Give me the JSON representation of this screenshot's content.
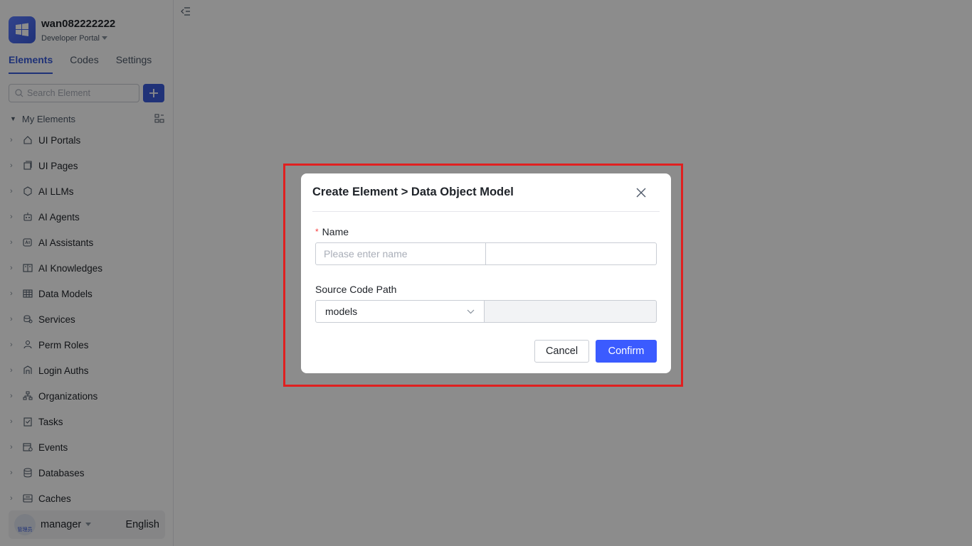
{
  "app": {
    "name": "wan082222222",
    "portal": "Developer Portal"
  },
  "tabs": [
    "Elements",
    "Codes",
    "Settings"
  ],
  "search": {
    "placeholder": "Search Element"
  },
  "tree": {
    "root_label": "My Elements",
    "items": [
      {
        "label": "UI Portals",
        "icon": "home-icon"
      },
      {
        "label": "UI Pages",
        "icon": "pages-icon"
      },
      {
        "label": "AI LLMs",
        "icon": "llm-icon"
      },
      {
        "label": "AI Agents",
        "icon": "robot-icon"
      },
      {
        "label": "AI Assistants",
        "icon": "ai-assistant-icon"
      },
      {
        "label": "AI Knowledges",
        "icon": "book-icon"
      },
      {
        "label": "Data Models",
        "icon": "table-icon"
      },
      {
        "label": "Services",
        "icon": "service-icon"
      },
      {
        "label": "Perm Roles",
        "icon": "role-icon"
      },
      {
        "label": "Login Auths",
        "icon": "login-icon"
      },
      {
        "label": "Organizations",
        "icon": "org-icon"
      },
      {
        "label": "Tasks",
        "icon": "task-icon"
      },
      {
        "label": "Events",
        "icon": "event-icon"
      },
      {
        "label": "Databases",
        "icon": "database-icon"
      },
      {
        "label": "Caches",
        "icon": "cache-icon"
      }
    ]
  },
  "footer": {
    "user": "manager",
    "avatar_text": "管理员",
    "language": "English"
  },
  "modal": {
    "title": "Create Element > Data Object Model",
    "name_label": "Name",
    "name_required_mark": "*",
    "name_placeholder": "Please enter name",
    "path_label": "Source Code Path",
    "path_value": "models",
    "cancel": "Cancel",
    "confirm": "Confirm"
  },
  "colors": {
    "accent": "#3b5bff",
    "highlight": "#e02020"
  }
}
